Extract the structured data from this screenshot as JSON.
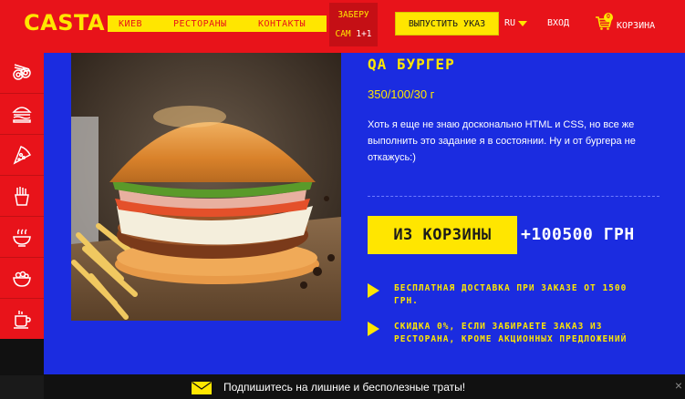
{
  "header": {
    "logo": "CASTA",
    "nav": [
      "КИЕВ",
      "РЕСТОРАНЫ",
      "КОНТАКТЫ"
    ],
    "promo_line1": "ЗАБЕРУ",
    "promo_line2_a": "САМ ",
    "promo_line2_b": "1+1",
    "launch_button": "ВЫПУСТИТЬ УКАЗ",
    "lang": "RU",
    "login": "ВХОД",
    "cart_label": "КОРЗИНА",
    "cart_count": "0"
  },
  "sidebar": {
    "items": [
      "sushi-icon",
      "burger-icon",
      "pizza-icon",
      "fries-icon",
      "bowl-icon",
      "salad-icon",
      "drink-icon"
    ]
  },
  "product": {
    "title": "QA БУРГЕР",
    "weight": "350/100/30 г",
    "description": "Хоть я еще не знаю досконально HTML и CSS, но все же выполнить это задание я в состоянии. Ну и от бургера не откажусь:)",
    "cart_button": "ИЗ КОРЗИНЫ",
    "price": "+100500 ГРН",
    "benefits": [
      "БЕСПЛАТНАЯ ДОСТАВКА ПРИ ЗАКАЗЕ ОТ 1500 ГРН.",
      "СКИДКА 0%, ЕСЛИ ЗАБИРАЕТЕ ЗАКАЗ ИЗ РЕСТОРАНА, КРОМЕ АКЦИОННЫХ ПРЕДЛОЖЕНИЙ"
    ]
  },
  "subscribe": {
    "text": "Подпишитесь на лишние и бесполезные траты!",
    "close": "×"
  },
  "colors": {
    "red": "#e8131a",
    "yellow": "#ffe600",
    "blue": "#1b2ce0",
    "dark": "#111111"
  }
}
